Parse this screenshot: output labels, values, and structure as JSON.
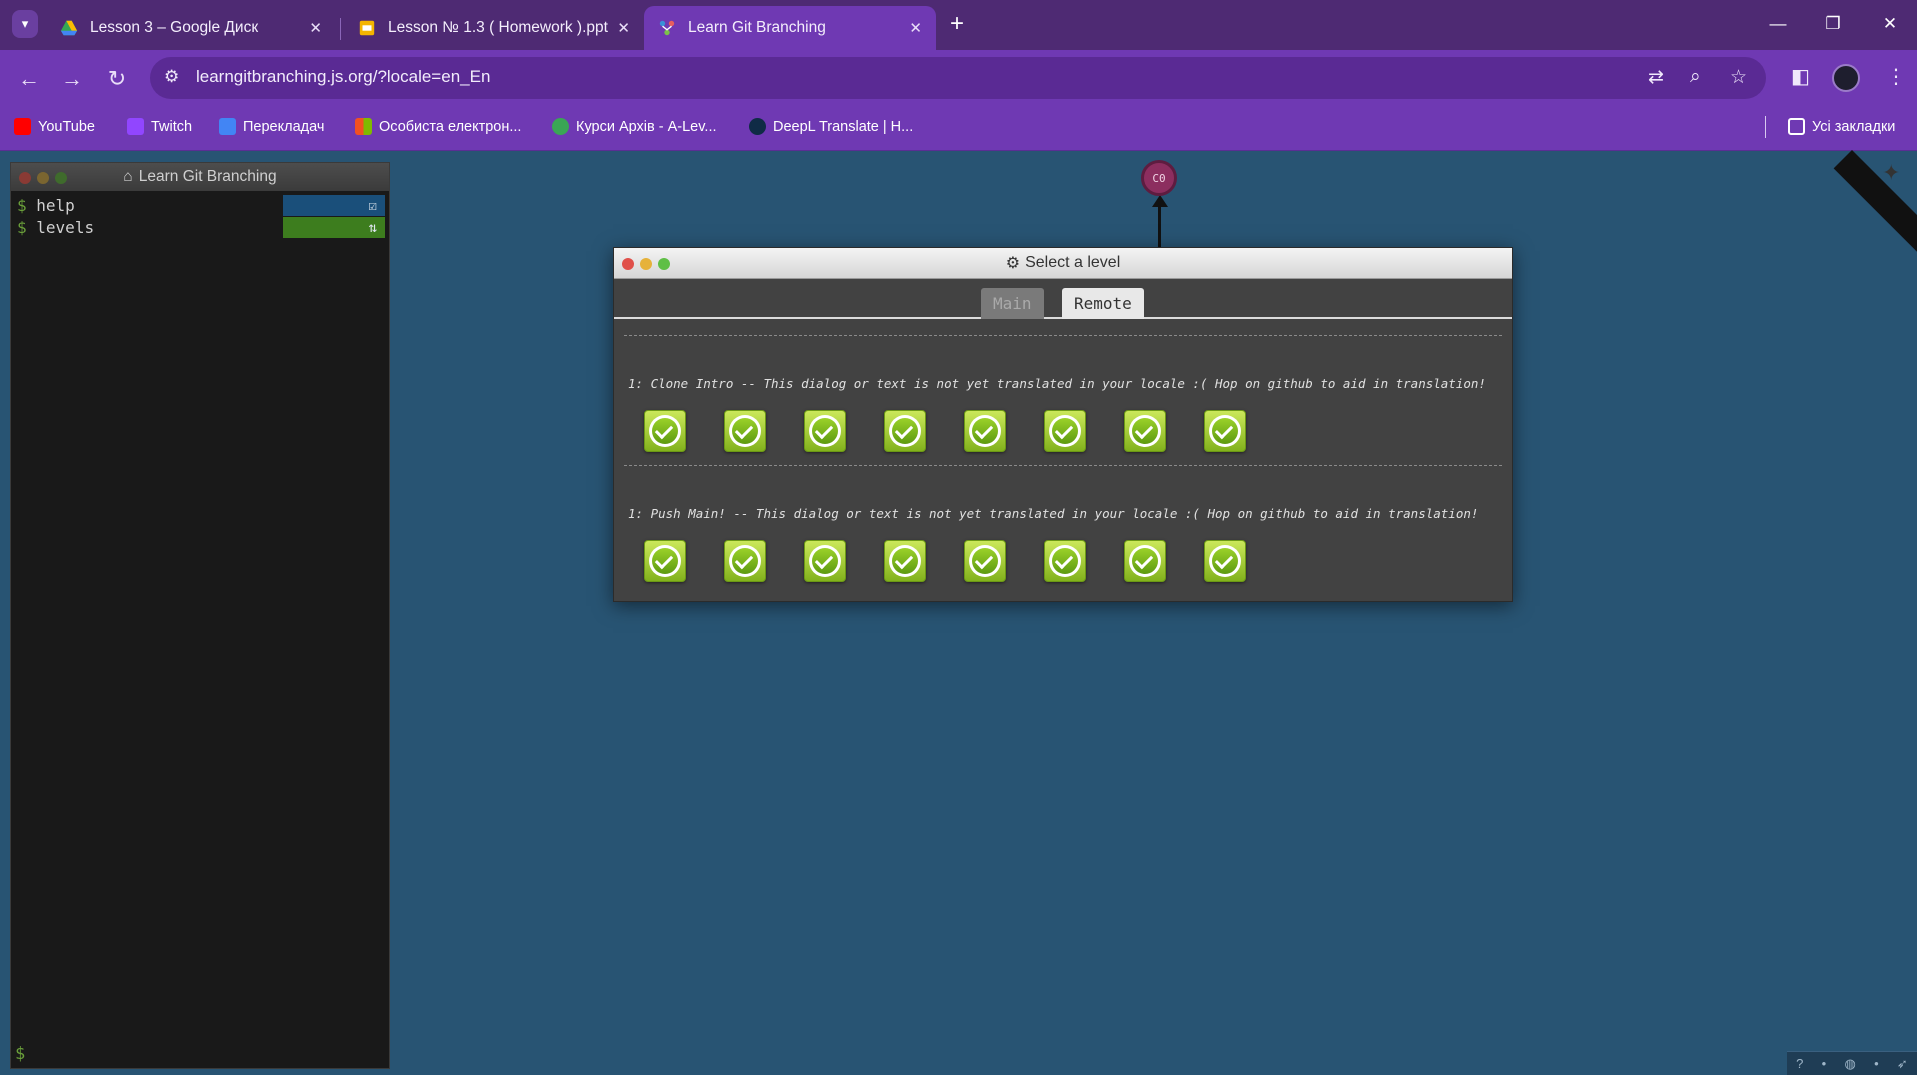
{
  "tabs": [
    {
      "title": "Lesson 3 – Google Диск",
      "icon": "google-drive-icon",
      "active": false
    },
    {
      "title": "Lesson № 1.3 ( Homework ).ppt",
      "icon": "google-slides-icon",
      "active": false
    },
    {
      "title": "Learn Git Branching",
      "icon": "git-branching-icon",
      "active": true
    }
  ],
  "address_bar": {
    "url": "learngitbranching.js.org/?locale=en_En"
  },
  "bookmarks": [
    {
      "label": "YouTube",
      "icon": "youtube-icon",
      "color": "#ff0000"
    },
    {
      "label": "Twitch",
      "icon": "twitch-icon",
      "color": "#9146ff"
    },
    {
      "label": "Перекладач",
      "icon": "google-translate-icon",
      "color": "#4285f4"
    },
    {
      "label": "Особиста електрон...",
      "icon": "microsoft-icon",
      "color": "#f25022"
    },
    {
      "label": "Курси Архів - A-Lev...",
      "icon": "a-level-icon",
      "color": "#3aa655"
    },
    {
      "label": "DeepL Translate | Н...",
      "icon": "deepl-icon",
      "color": "#0f2b46"
    }
  ],
  "all_bookmarks_label": "Усі закладки",
  "terminal": {
    "title": "Learn Git Branching",
    "prompt": "$",
    "history": [
      {
        "command": "help",
        "bar_color": "#1a4f7a",
        "status_icon": "checkbox-icon"
      },
      {
        "command": "levels",
        "bar_color": "#3d7d1e",
        "status_icon": "refresh-icon"
      }
    ]
  },
  "visualization": {
    "commit_label": "C0"
  },
  "dialog": {
    "title": "Select a level",
    "tabs": [
      {
        "label": "Main",
        "active": false
      },
      {
        "label": "Remote",
        "active": true
      }
    ],
    "sequences": [
      {
        "title": "1: Clone Intro -- This dialog or text is not yet translated in your locale :( Hop on github to aid in translation!",
        "levels_completed": 8
      },
      {
        "title": "1: Push Main! -- This dialog or text is not yet translated in your locale :( Hop on github to aid in translation!",
        "levels_completed": 8
      }
    ]
  },
  "colors": {
    "page_background": "#285473",
    "browser_accent": "#6f39b3",
    "level_completed": "#8fc126"
  }
}
